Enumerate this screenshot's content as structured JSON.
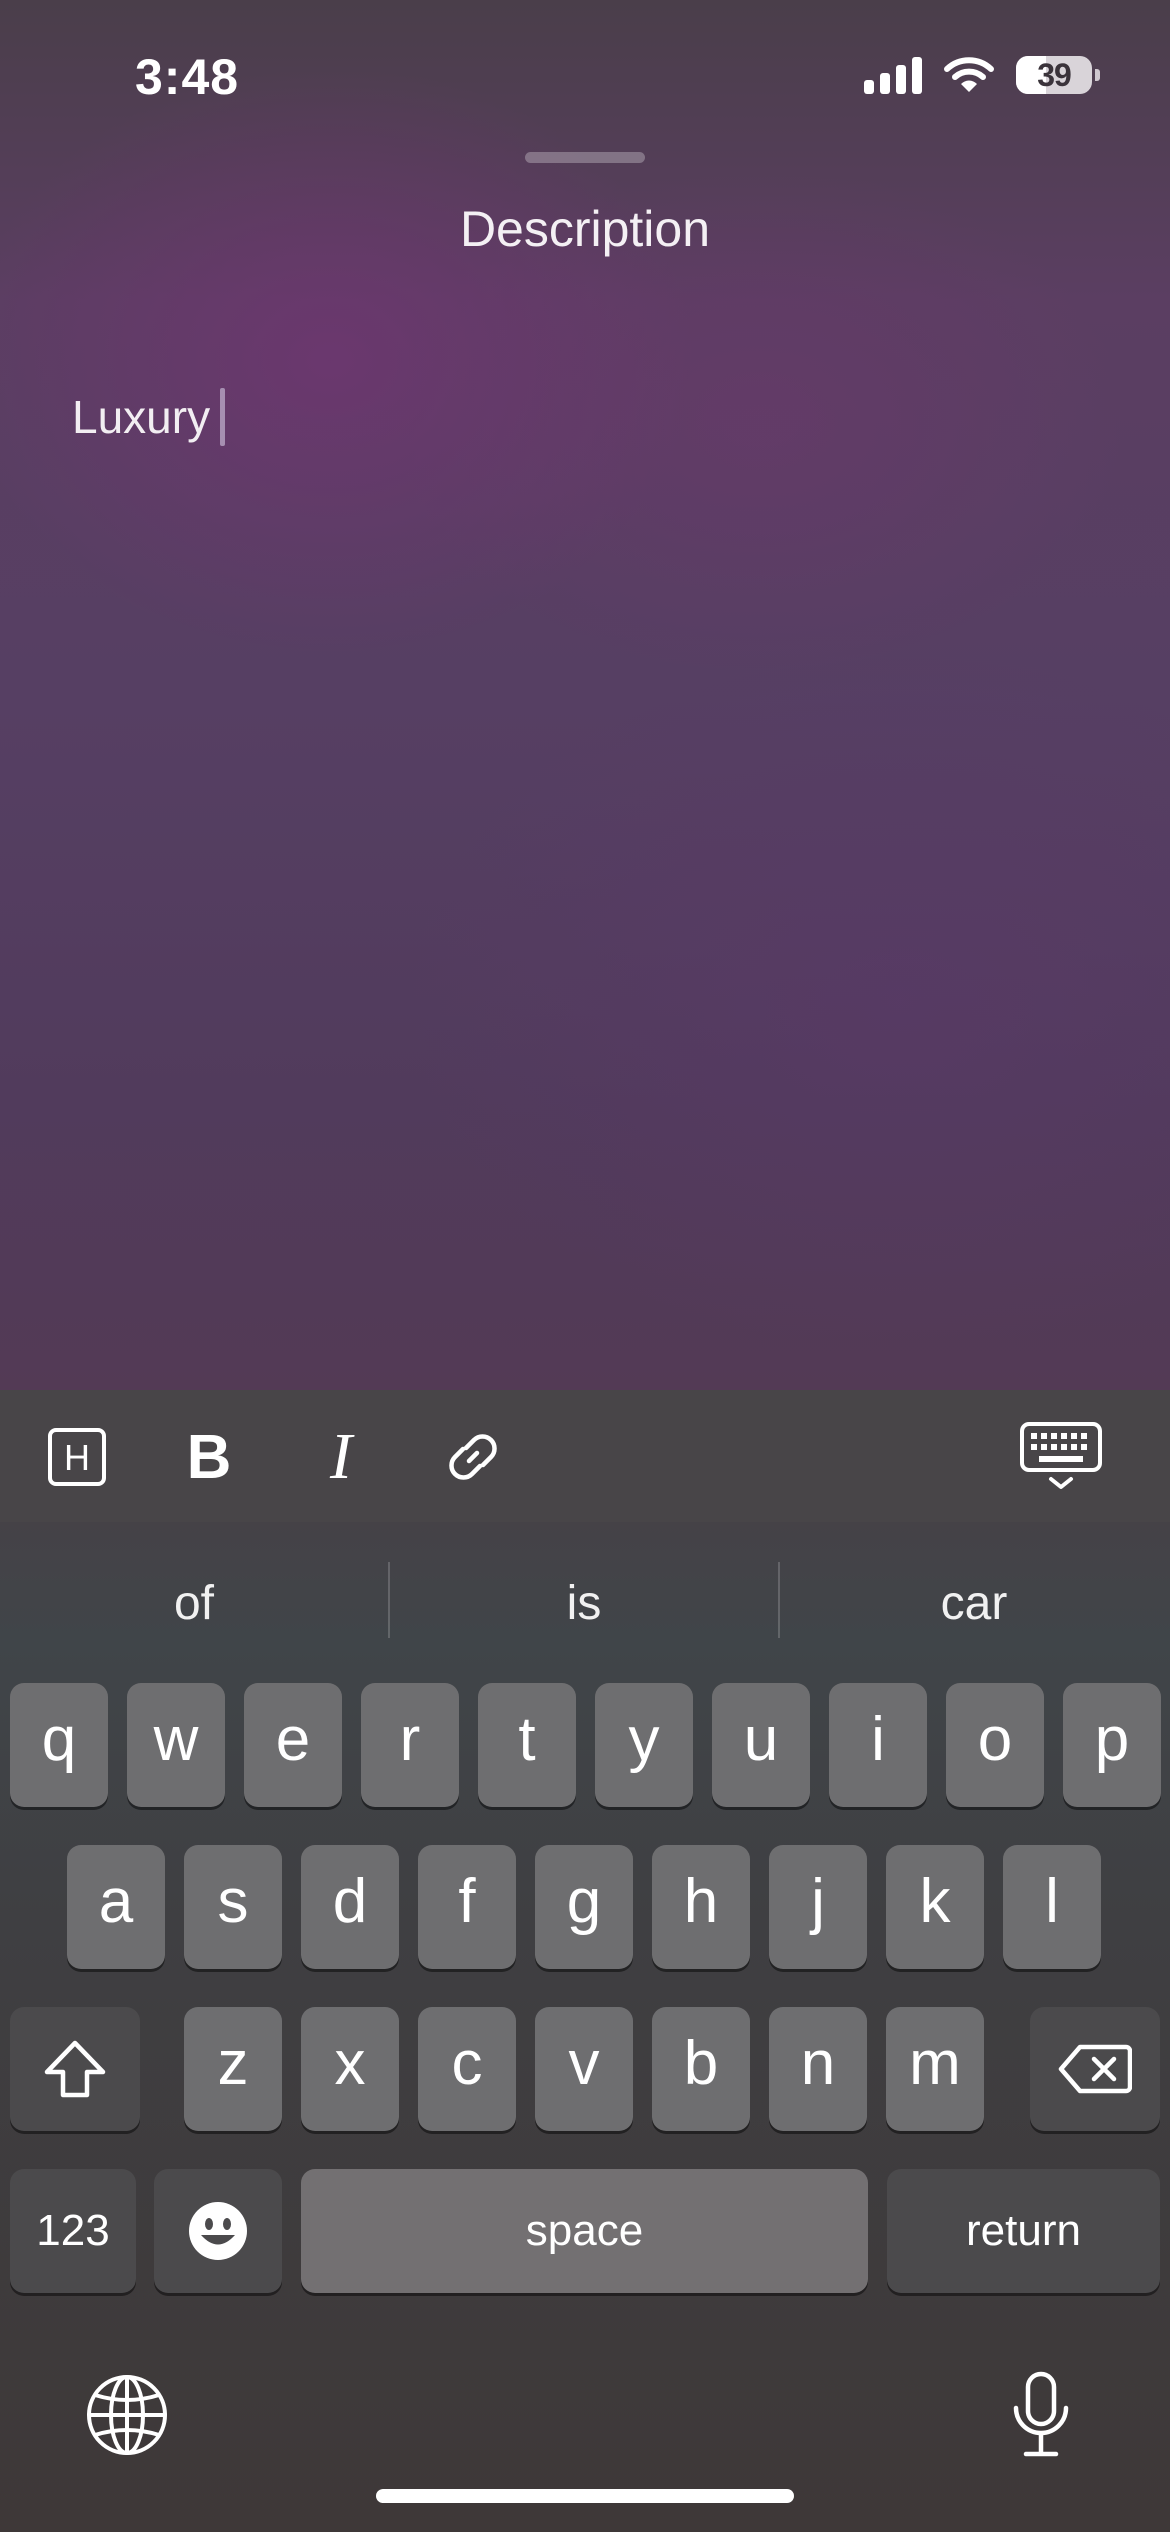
{
  "status_bar": {
    "time": "3:48",
    "battery_level": "39",
    "icons": [
      "signal-icon",
      "wifi-icon",
      "battery-icon"
    ]
  },
  "sheet": {
    "title": "Description"
  },
  "editor": {
    "text": "Luxury"
  },
  "toolbar": {
    "items": [
      "heading-icon",
      "bold-icon",
      "italic-icon",
      "link-icon",
      "keyboard-dismiss-icon"
    ],
    "bold_glyph": "B",
    "italic_glyph": "I",
    "heading_glyph": "H"
  },
  "keyboard": {
    "suggestions": [
      "of",
      "is",
      "car"
    ],
    "row1": [
      "q",
      "w",
      "e",
      "r",
      "t",
      "y",
      "u",
      "i",
      "o",
      "p"
    ],
    "row2": [
      "a",
      "s",
      "d",
      "f",
      "g",
      "h",
      "j",
      "k",
      "l"
    ],
    "row3": [
      "z",
      "x",
      "c",
      "v",
      "b",
      "n",
      "m"
    ],
    "numbers_label": "123",
    "space_label": "space",
    "return_label": "return",
    "icons": [
      "shift-icon",
      "delete-icon",
      "emoji-icon",
      "globe-icon",
      "microphone-icon"
    ]
  },
  "colors": {
    "key_background": "#6e6e70",
    "key_dark_background": "#4b4a4c",
    "toolbar_background": "#484548",
    "caret": "#a68fb1"
  }
}
